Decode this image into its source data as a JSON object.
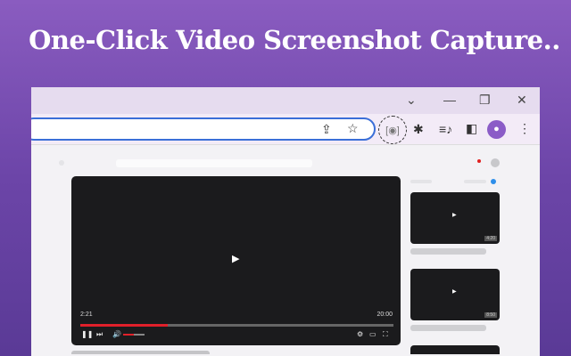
{
  "headline": "One-Click Video Screenshot Capture..",
  "player": {
    "current_time": "2:21",
    "duration": "20:00",
    "progress_fraction": 0.28
  },
  "thumbs": [
    {
      "duration": "4:20"
    },
    {
      "duration": "8:50"
    }
  ],
  "colors": {
    "accent": "#3b6fd8",
    "progress": "#e0202a"
  }
}
